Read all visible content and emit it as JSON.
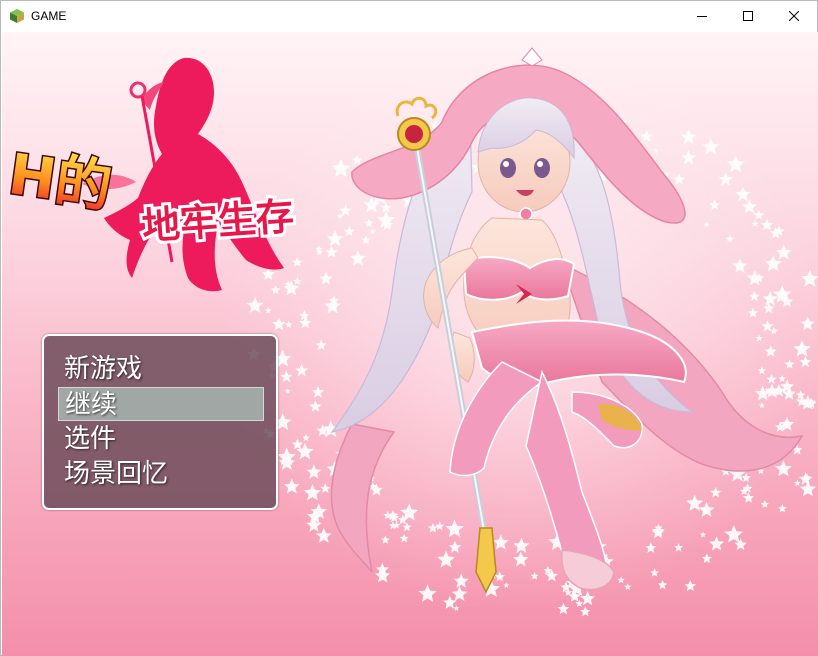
{
  "window": {
    "title": "GAME",
    "controls": {
      "minimize_icon": "minimize-icon",
      "maximize_icon": "maximize-icon",
      "close_icon": "close-icon"
    }
  },
  "logo": {
    "text_h": "H的",
    "text_main": "地牢生存"
  },
  "menu": {
    "items": [
      {
        "label": "新游戏"
      },
      {
        "label": "继续",
        "selected": true
      },
      {
        "label": "选件"
      },
      {
        "label": "场景回忆"
      }
    ]
  },
  "colors": {
    "background_top": "#fff4f7",
    "background_bottom": "#f48fab",
    "menu_bg": "#684856",
    "selection": "#aabcb6",
    "logo_red": "#e8174a"
  }
}
